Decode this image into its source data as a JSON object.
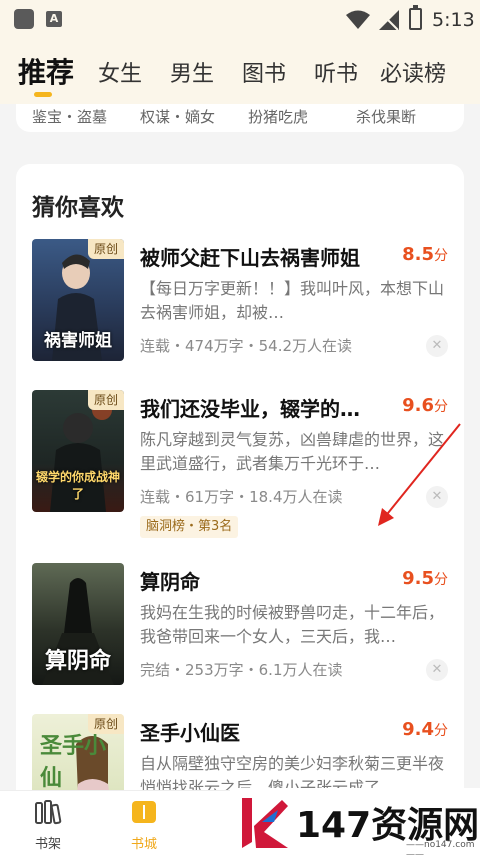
{
  "statusbar": {
    "time": "5:13",
    "a_icon": "A"
  },
  "tabs": [
    "推荐",
    "女生",
    "男生",
    "图书",
    "听书",
    "必读榜"
  ],
  "sub_tags": [
    "鉴宝・盗墓",
    "权谋・嫡女",
    "扮猪吃虎",
    "杀伐果断"
  ],
  "section_title": "猜你喜欢",
  "books": [
    {
      "title": "被师父赶下山去祸害师姐",
      "score": "8.5",
      "score_unit": "分",
      "desc": "【每日万字更新！！】我叫叶风，本想下山去祸害师姐，却被…",
      "meta": "连载・474万字・54.2万人在读",
      "badge": "原创",
      "cover_text": "祸害师姐"
    },
    {
      "title": "我们还没毕业，辍学的…",
      "score": "9.6",
      "score_unit": "分",
      "desc": "陈凡穿越到灵气复苏，凶兽肆虐的世界，这里武道盛行，武者集万千光环于…",
      "meta": "连载・61万字・18.4万人在读",
      "badge": "原创",
      "rank": "脑洞榜・第3名",
      "cover_text": "辍学的你成战神了"
    },
    {
      "title": "算阴命",
      "score": "9.5",
      "score_unit": "分",
      "desc": "我妈在生我的时候被野兽叼走，十二年后，我爸带回来一个女人，三天后，我…",
      "meta": "完结・253万字・6.1万人在读",
      "cover_text": "算阴命"
    },
    {
      "title": "圣手小仙医",
      "score": "9.4",
      "score_unit": "分",
      "desc": "自从隔壁独守空房的美少妇李秋菊三更半夜悄悄找张云之后，傻小子张云成了…",
      "badge": "原创",
      "cover_text": "圣手小仙"
    }
  ],
  "bottom_nav": [
    {
      "label": "书架",
      "icon": "bookshelf-icon"
    },
    {
      "label": "书城",
      "icon": "bookstore-icon"
    }
  ],
  "watermark": {
    "text": "147资源网",
    "url": "——no147.com——"
  },
  "colors": {
    "accent": "#f5b51d",
    "score": "#e8501f",
    "header_bg": "#fbf6ea"
  }
}
